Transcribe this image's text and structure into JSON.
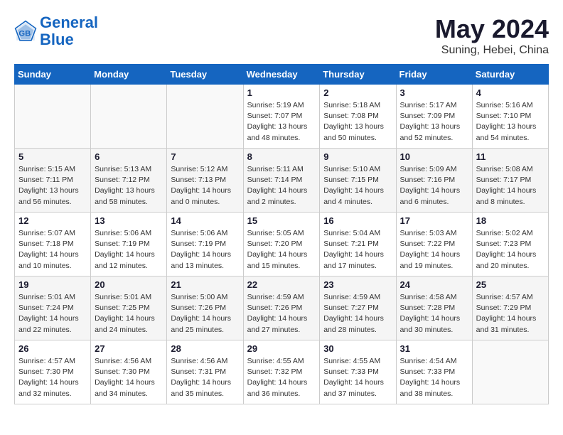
{
  "header": {
    "logo_line1": "General",
    "logo_line2": "Blue",
    "month_year": "May 2024",
    "location": "Suning, Hebei, China"
  },
  "weekdays": [
    "Sunday",
    "Monday",
    "Tuesday",
    "Wednesday",
    "Thursday",
    "Friday",
    "Saturday"
  ],
  "weeks": [
    [
      {
        "day": "",
        "info": ""
      },
      {
        "day": "",
        "info": ""
      },
      {
        "day": "",
        "info": ""
      },
      {
        "day": "1",
        "sunrise": "Sunrise: 5:19 AM",
        "sunset": "Sunset: 7:07 PM",
        "daylight": "Daylight: 13 hours and 48 minutes."
      },
      {
        "day": "2",
        "sunrise": "Sunrise: 5:18 AM",
        "sunset": "Sunset: 7:08 PM",
        "daylight": "Daylight: 13 hours and 50 minutes."
      },
      {
        "day": "3",
        "sunrise": "Sunrise: 5:17 AM",
        "sunset": "Sunset: 7:09 PM",
        "daylight": "Daylight: 13 hours and 52 minutes."
      },
      {
        "day": "4",
        "sunrise": "Sunrise: 5:16 AM",
        "sunset": "Sunset: 7:10 PM",
        "daylight": "Daylight: 13 hours and 54 minutes."
      }
    ],
    [
      {
        "day": "5",
        "sunrise": "Sunrise: 5:15 AM",
        "sunset": "Sunset: 7:11 PM",
        "daylight": "Daylight: 13 hours and 56 minutes."
      },
      {
        "day": "6",
        "sunrise": "Sunrise: 5:13 AM",
        "sunset": "Sunset: 7:12 PM",
        "daylight": "Daylight: 13 hours and 58 minutes."
      },
      {
        "day": "7",
        "sunrise": "Sunrise: 5:12 AM",
        "sunset": "Sunset: 7:13 PM",
        "daylight": "Daylight: 14 hours and 0 minutes."
      },
      {
        "day": "8",
        "sunrise": "Sunrise: 5:11 AM",
        "sunset": "Sunset: 7:14 PM",
        "daylight": "Daylight: 14 hours and 2 minutes."
      },
      {
        "day": "9",
        "sunrise": "Sunrise: 5:10 AM",
        "sunset": "Sunset: 7:15 PM",
        "daylight": "Daylight: 14 hours and 4 minutes."
      },
      {
        "day": "10",
        "sunrise": "Sunrise: 5:09 AM",
        "sunset": "Sunset: 7:16 PM",
        "daylight": "Daylight: 14 hours and 6 minutes."
      },
      {
        "day": "11",
        "sunrise": "Sunrise: 5:08 AM",
        "sunset": "Sunset: 7:17 PM",
        "daylight": "Daylight: 14 hours and 8 minutes."
      }
    ],
    [
      {
        "day": "12",
        "sunrise": "Sunrise: 5:07 AM",
        "sunset": "Sunset: 7:18 PM",
        "daylight": "Daylight: 14 hours and 10 minutes."
      },
      {
        "day": "13",
        "sunrise": "Sunrise: 5:06 AM",
        "sunset": "Sunset: 7:19 PM",
        "daylight": "Daylight: 14 hours and 12 minutes."
      },
      {
        "day": "14",
        "sunrise": "Sunrise: 5:06 AM",
        "sunset": "Sunset: 7:19 PM",
        "daylight": "Daylight: 14 hours and 13 minutes."
      },
      {
        "day": "15",
        "sunrise": "Sunrise: 5:05 AM",
        "sunset": "Sunset: 7:20 PM",
        "daylight": "Daylight: 14 hours and 15 minutes."
      },
      {
        "day": "16",
        "sunrise": "Sunrise: 5:04 AM",
        "sunset": "Sunset: 7:21 PM",
        "daylight": "Daylight: 14 hours and 17 minutes."
      },
      {
        "day": "17",
        "sunrise": "Sunrise: 5:03 AM",
        "sunset": "Sunset: 7:22 PM",
        "daylight": "Daylight: 14 hours and 19 minutes."
      },
      {
        "day": "18",
        "sunrise": "Sunrise: 5:02 AM",
        "sunset": "Sunset: 7:23 PM",
        "daylight": "Daylight: 14 hours and 20 minutes."
      }
    ],
    [
      {
        "day": "19",
        "sunrise": "Sunrise: 5:01 AM",
        "sunset": "Sunset: 7:24 PM",
        "daylight": "Daylight: 14 hours and 22 minutes."
      },
      {
        "day": "20",
        "sunrise": "Sunrise: 5:01 AM",
        "sunset": "Sunset: 7:25 PM",
        "daylight": "Daylight: 14 hours and 24 minutes."
      },
      {
        "day": "21",
        "sunrise": "Sunrise: 5:00 AM",
        "sunset": "Sunset: 7:26 PM",
        "daylight": "Daylight: 14 hours and 25 minutes."
      },
      {
        "day": "22",
        "sunrise": "Sunrise: 4:59 AM",
        "sunset": "Sunset: 7:26 PM",
        "daylight": "Daylight: 14 hours and 27 minutes."
      },
      {
        "day": "23",
        "sunrise": "Sunrise: 4:59 AM",
        "sunset": "Sunset: 7:27 PM",
        "daylight": "Daylight: 14 hours and 28 minutes."
      },
      {
        "day": "24",
        "sunrise": "Sunrise: 4:58 AM",
        "sunset": "Sunset: 7:28 PM",
        "daylight": "Daylight: 14 hours and 30 minutes."
      },
      {
        "day": "25",
        "sunrise": "Sunrise: 4:57 AM",
        "sunset": "Sunset: 7:29 PM",
        "daylight": "Daylight: 14 hours and 31 minutes."
      }
    ],
    [
      {
        "day": "26",
        "sunrise": "Sunrise: 4:57 AM",
        "sunset": "Sunset: 7:30 PM",
        "daylight": "Daylight: 14 hours and 32 minutes."
      },
      {
        "day": "27",
        "sunrise": "Sunrise: 4:56 AM",
        "sunset": "Sunset: 7:30 PM",
        "daylight": "Daylight: 14 hours and 34 minutes."
      },
      {
        "day": "28",
        "sunrise": "Sunrise: 4:56 AM",
        "sunset": "Sunset: 7:31 PM",
        "daylight": "Daylight: 14 hours and 35 minutes."
      },
      {
        "day": "29",
        "sunrise": "Sunrise: 4:55 AM",
        "sunset": "Sunset: 7:32 PM",
        "daylight": "Daylight: 14 hours and 36 minutes."
      },
      {
        "day": "30",
        "sunrise": "Sunrise: 4:55 AM",
        "sunset": "Sunset: 7:33 PM",
        "daylight": "Daylight: 14 hours and 37 minutes."
      },
      {
        "day": "31",
        "sunrise": "Sunrise: 4:54 AM",
        "sunset": "Sunset: 7:33 PM",
        "daylight": "Daylight: 14 hours and 38 minutes."
      },
      {
        "day": "",
        "info": ""
      }
    ]
  ]
}
